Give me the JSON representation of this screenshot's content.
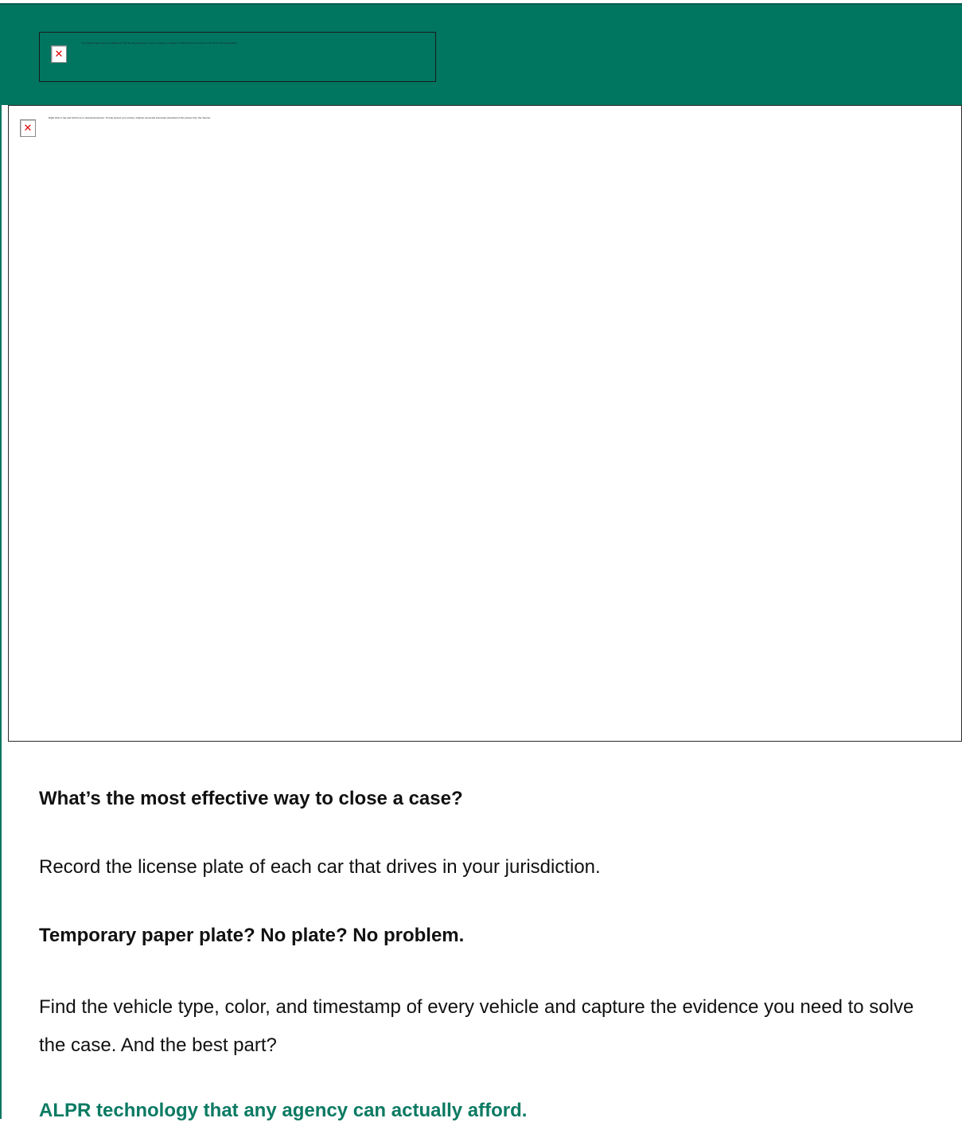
{
  "header": {
    "image_alt_text": "The linked image cannot be displayed. The file may have been moved, renamed, or deleted. Verify that the link points to the correct file and location."
  },
  "hero": {
    "image_alt_text": "Right-click or tap and hold here to download pictures. To help protect your privacy, Outlook prevented automatic download of this picture from the Internet."
  },
  "body": {
    "heading1": "What’s the most effective way to close a case?",
    "paragraph1": "Record the license plate of each car that drives in your jurisdiction.",
    "heading2": "Temporary paper plate? No plate? No problem.",
    "paragraph2": "Find the vehicle type, color, and timestamp of every vehicle and capture the evidence you need to solve the case. And the best part?",
    "cta": "ALPR technology that any agency can actually afford."
  },
  "colors": {
    "header_bg": "#007560",
    "accent_text": "#0b7a63"
  }
}
